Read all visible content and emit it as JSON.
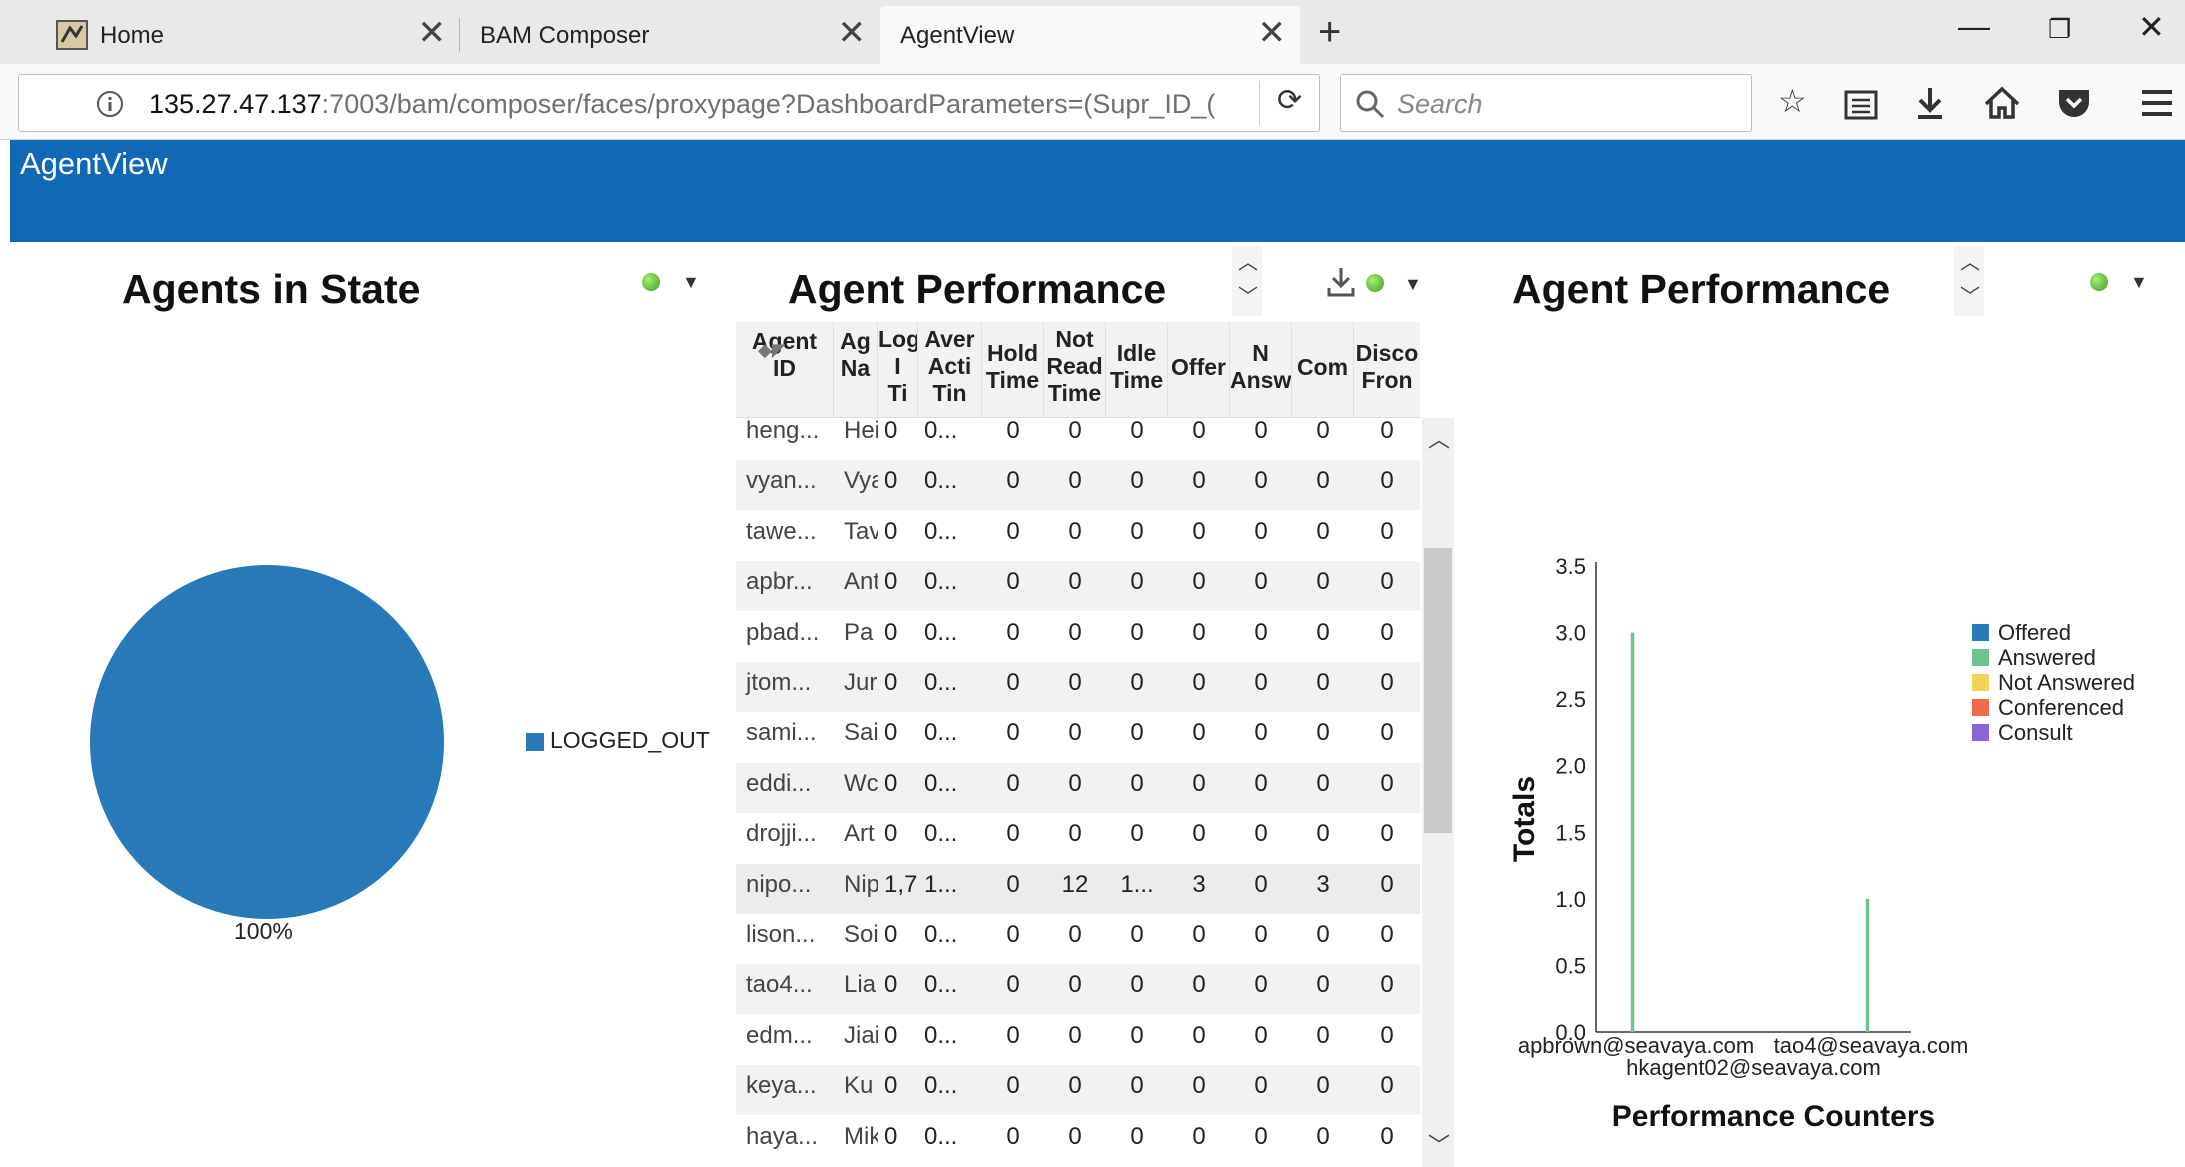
{
  "browser": {
    "tabs": [
      {
        "label": "Home"
      },
      {
        "label": "BAM Composer"
      },
      {
        "label": "AgentView"
      }
    ],
    "url_host": "135.27.47.137",
    "url_path": ":7003/bam/composer/faces/proxypage?DashboardParameters=(Supr_ID_(",
    "search_placeholder": "Search"
  },
  "app": {
    "title": "AgentView"
  },
  "pie_panel": {
    "title": "Agents in State",
    "legend": "LOGGED_OUT",
    "percent_label": "100%",
    "slice_color": "#2779b8"
  },
  "table_panel": {
    "title": "Agent Performance",
    "columns": [
      "Agent\nID",
      "Ag\nNa",
      "Log\nI\nTi",
      "Aver\nActi\nTin",
      "Hold\nTime",
      "Not\nRead\nTime",
      "Idle\nTime",
      "Offer",
      "N\nAnsw",
      "Com",
      "Disco\nFron"
    ],
    "rows": [
      [
        "heng...",
        "Hei",
        "0",
        "0...",
        "0",
        "0",
        "0",
        "0",
        "0",
        "0",
        "0"
      ],
      [
        "vyan...",
        "Vya",
        "0",
        "0...",
        "0",
        "0",
        "0",
        "0",
        "0",
        "0",
        "0"
      ],
      [
        "tawe...",
        "Tav",
        "0",
        "0...",
        "0",
        "0",
        "0",
        "0",
        "0",
        "0",
        "0"
      ],
      [
        "apbr...",
        "Ant",
        "0",
        "0...",
        "0",
        "0",
        "0",
        "0",
        "0",
        "0",
        "0"
      ],
      [
        "pbad...",
        "Pa",
        "0",
        "0...",
        "0",
        "0",
        "0",
        "0",
        "0",
        "0",
        "0"
      ],
      [
        "jtom...",
        "Jur",
        "0",
        "0...",
        "0",
        "0",
        "0",
        "0",
        "0",
        "0",
        "0"
      ],
      [
        "sami...",
        "Sai",
        "0",
        "0...",
        "0",
        "0",
        "0",
        "0",
        "0",
        "0",
        "0"
      ],
      [
        "eddi...",
        "Wc",
        "0",
        "0...",
        "0",
        "0",
        "0",
        "0",
        "0",
        "0",
        "0"
      ],
      [
        "drojji...",
        "Art",
        "0",
        "0...",
        "0",
        "0",
        "0",
        "0",
        "0",
        "0",
        "0"
      ],
      [
        "nipo...",
        "Nip",
        "1,7",
        "1...",
        "0",
        "12",
        "1...",
        "3",
        "0",
        "3",
        "0"
      ],
      [
        "lison...",
        "Soi",
        "0",
        "0...",
        "0",
        "0",
        "0",
        "0",
        "0",
        "0",
        "0"
      ],
      [
        "tao4...",
        "Lia",
        "0",
        "0...",
        "0",
        "0",
        "0",
        "0",
        "0",
        "0",
        "0"
      ],
      [
        "edm...",
        "Jiai",
        "0",
        "0...",
        "0",
        "0",
        "0",
        "0",
        "0",
        "0",
        "0"
      ],
      [
        "keya...",
        "Ku",
        "0",
        "0...",
        "0",
        "0",
        "0",
        "0",
        "0",
        "0",
        "0"
      ],
      [
        "haya...",
        "Mik",
        "0",
        "0...",
        "0",
        "0",
        "0",
        "0",
        "0",
        "0",
        "0"
      ]
    ]
  },
  "chart_panel": {
    "title": "Agent Performance"
  },
  "chart_data": {
    "type": "bar",
    "ylabel": "Totals",
    "xlabel": "Performance Counters",
    "categories": [
      "apbrown@seavaya.com",
      "hkagent02@seavaya.com",
      "tao4@seavaya.com"
    ],
    "series": [
      {
        "name": "Offered",
        "color": "#2779b8",
        "values": [
          0,
          0,
          0
        ]
      },
      {
        "name": "Answered",
        "color": "#6fc28f",
        "values": [
          3,
          0,
          1
        ]
      },
      {
        "name": "Not Answered",
        "color": "#f2d35a",
        "values": [
          0,
          0,
          0
        ]
      },
      {
        "name": "Conferenced",
        "color": "#ef6a4a",
        "values": [
          0,
          0,
          0
        ]
      },
      {
        "name": "Consult",
        "color": "#8d63d8",
        "values": [
          0,
          0,
          0
        ]
      }
    ],
    "ylim": [
      0,
      3.5
    ],
    "yticks": [
      "0.0",
      "0.5",
      "1.0",
      "1.5",
      "2.0",
      "2.5",
      "3.0",
      "3.5"
    ],
    "legend_position": "right"
  }
}
